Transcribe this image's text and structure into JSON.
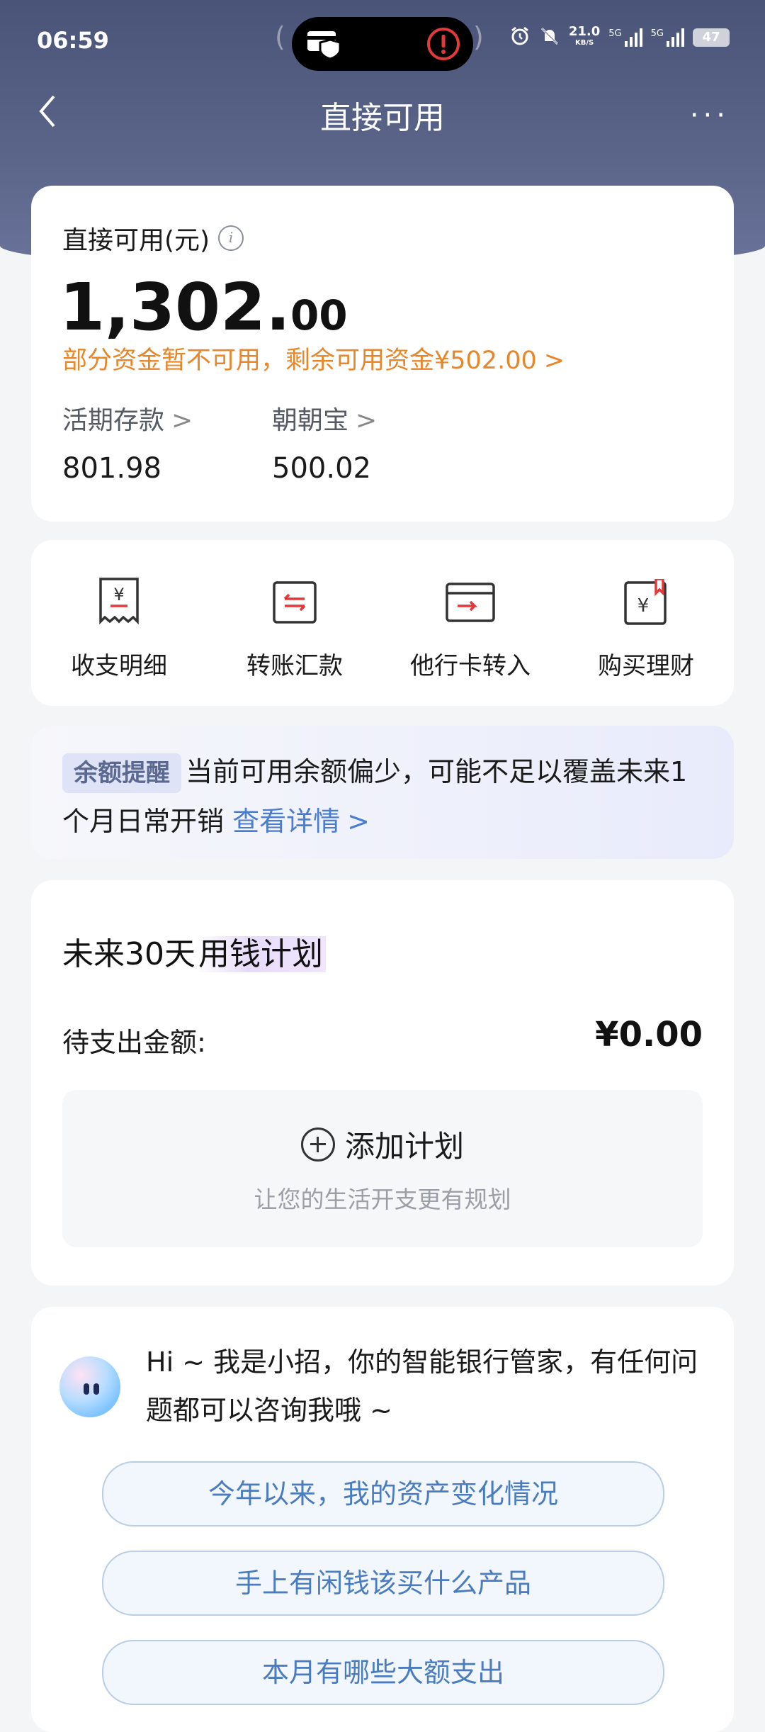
{
  "status_bar": {
    "time": "06:59",
    "speed": "21.0",
    "speed_unit": "KB/S",
    "net1": "5G",
    "net2": "5G",
    "battery": "47"
  },
  "nav": {
    "title": "直接可用",
    "more": "···"
  },
  "balance": {
    "label": "直接可用(元)",
    "amount_int": "1,302.",
    "amount_dec": "00",
    "note": "部分资金暂不可用，剩余可用资金¥502.00",
    "accounts": [
      {
        "label": "活期存款",
        "value": "801.98"
      },
      {
        "label": "朝朝宝",
        "value": "500.02"
      }
    ]
  },
  "quick_actions": [
    {
      "label": "收支明细",
      "icon": "receipt-yuan-icon"
    },
    {
      "label": "转账汇款",
      "icon": "transfer-icon"
    },
    {
      "label": "他行卡转入",
      "icon": "card-in-icon"
    },
    {
      "label": "购买理财",
      "icon": "wealth-bookmark-icon"
    }
  ],
  "reminder": {
    "tag": "余额提醒",
    "text": "当前可用余额偏少，可能不足以覆盖未来1个月日常开销",
    "link": "查看详情"
  },
  "plan": {
    "title_prefix": "未来30天",
    "title_highlight": "用钱计划",
    "pending_label": "待支出金额:",
    "pending_amount": "¥0.00",
    "add_label": "添加计划",
    "add_sub": "让您的生活开支更有规划"
  },
  "assistant": {
    "greeting": "Hi ~ 我是小招，你的智能银行管家，有任何问题都可以咨询我哦 ~",
    "suggestions": [
      "今年以来，我的资产变化情况",
      "手上有闲钱该买什么产品",
      "本月有哪些大额支出"
    ]
  },
  "colors": {
    "header": "#4a5478",
    "accent_orange": "#e8862a",
    "link_blue": "#4a7ccf",
    "icon_red": "#e03a3a"
  }
}
